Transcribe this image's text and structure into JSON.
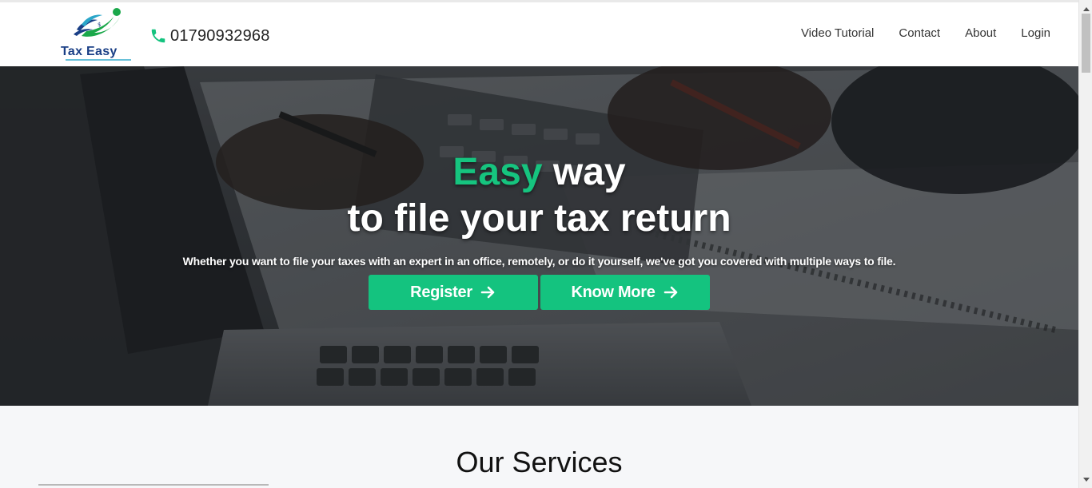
{
  "navbar": {
    "logo_text": "Tax Easy",
    "phone": "01790932968",
    "links": [
      "Video Tutorial",
      "Contact",
      "About",
      "Login"
    ]
  },
  "hero": {
    "title_accent": "Easy",
    "title_rest_line1": "way",
    "title_line2": "to file your tax return",
    "subtitle": "Whether you want to file your taxes with an expert in an office, remotely, or do it yourself, we've got you covered with multiple ways to file.",
    "register_label": "Register",
    "know_more_label": "Know More"
  },
  "services": {
    "title": "Our Services"
  },
  "colors": {
    "accent": "#14c37f",
    "logo_blue": "#1a3f86",
    "logo_green": "#1aa84a"
  },
  "icons": {
    "phone": "phone-icon",
    "arrow": "arrow-right-icon"
  }
}
